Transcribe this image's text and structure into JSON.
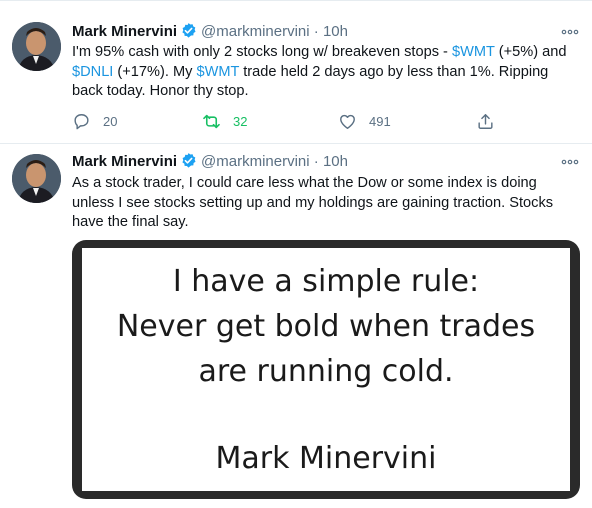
{
  "colors": {
    "link": "#1b95e0",
    "verified": "#1da1f2",
    "retweet_active": "#17bf63",
    "muted": "#5b7083"
  },
  "tweets": [
    {
      "author_name": "Mark Minervini",
      "handle": "@markminervini",
      "separator": "·",
      "time": "10h",
      "icons": [
        "avatar",
        "verified-badge-icon",
        "more-icon"
      ],
      "text_segments": [
        {
          "text": "I'm 95% cash with only 2 stocks long w/ breakeven stops - ",
          "type": "plain"
        },
        {
          "text": "$WMT",
          "type": "cashtag"
        },
        {
          "text": " (+5%) and ",
          "type": "plain"
        },
        {
          "text": "$DNLI",
          "type": "cashtag"
        },
        {
          "text": " (+17%). My ",
          "type": "plain"
        },
        {
          "text": "$WMT",
          "type": "cashtag"
        },
        {
          "text": " trade held 2 days ago by less than 1%. Ripping back today. Honor thy stop.",
          "type": "plain"
        }
      ],
      "actions": {
        "reply_count": "20",
        "retweet_count": "32",
        "like_count": "491",
        "icons": [
          "reply-icon",
          "retweet-icon",
          "like-icon",
          "share-icon"
        ]
      }
    },
    {
      "author_name": "Mark Minervini",
      "handle": "@markminervini",
      "separator": "·",
      "time": "10h",
      "icons": [
        "avatar",
        "verified-badge-icon",
        "more-icon"
      ],
      "text": "As a stock trader, I could care less what the Dow or some index is doing unless I see stocks setting up and my holdings are gaining traction. Stocks have the final say.",
      "image": {
        "line1": "I have a simple rule:",
        "line2": "Never get bold when trades",
        "line3": "are running cold.",
        "author": "Mark Minervini"
      }
    }
  ]
}
